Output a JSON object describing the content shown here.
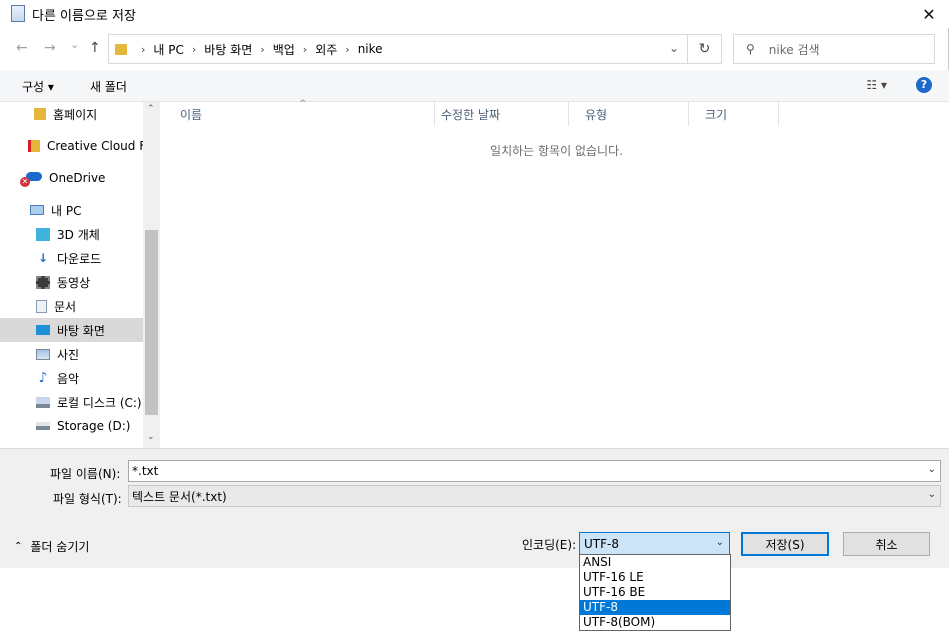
{
  "window": {
    "title": "다른 이름으로 저장",
    "close_glyph": "✕"
  },
  "address": {
    "back_glyph": "←",
    "forward_glyph": "→",
    "dropdown_glyph": "⌄",
    "up_glyph": "↑",
    "breadcrumbs": [
      "내 PC",
      "바탕 화면",
      "백업",
      "외주",
      "nike"
    ],
    "separator": "›",
    "refresh_glyph": "↻",
    "search_placeholder": "nike 검색"
  },
  "toolbar": {
    "organize_label": "구성 ▾",
    "new_folder_label": "새 폴더",
    "view_glyph": "☷ ▾",
    "help_glyph": "?"
  },
  "nav_pane": {
    "items": [
      {
        "label": "홈페이지",
        "icon": "folder-icon"
      },
      {
        "label": "Creative Cloud Fil",
        "icon": "creative-cloud-icon"
      },
      {
        "label": "OneDrive",
        "icon": "onedrive-icon"
      },
      {
        "label": "내 PC",
        "icon": "computer-icon"
      },
      {
        "label": "3D 개체",
        "icon": "cube-icon"
      },
      {
        "label": "다운로드",
        "icon": "download-icon"
      },
      {
        "label": "동영상",
        "icon": "video-icon"
      },
      {
        "label": "문서",
        "icon": "document-icon"
      },
      {
        "label": "바탕 화면",
        "icon": "desktop-icon"
      },
      {
        "label": "사진",
        "icon": "picture-icon"
      },
      {
        "label": "음악",
        "icon": "music-icon"
      },
      {
        "label": "로컬 디스크 (C:)",
        "icon": "drive-icon"
      },
      {
        "label": "Storage (D:)",
        "icon": "drive-icon"
      }
    ],
    "selected_index": 8,
    "scroll_up_glyph": "⌃",
    "scroll_down_glyph": "⌄"
  },
  "file_list": {
    "columns": [
      "이름",
      "수정한 날짜",
      "유형",
      "크기"
    ],
    "sort_glyph": "^",
    "empty_message": "일치하는 항목이 없습니다."
  },
  "bottom": {
    "filename_label": "파일 이름(N):",
    "filename_value": "*.txt",
    "filetype_label": "파일 형식(T):",
    "filetype_value": "텍스트 문서(*.txt)",
    "hide_folders_label": "폴더 숨기기",
    "hide_folders_glyph": "⌃",
    "encoding_label": "인코딩(E):",
    "encoding_value": "UTF-8",
    "save_label": "저장(S)",
    "cancel_label": "취소",
    "dropdown_glyph": "⌄"
  },
  "encoding_options": [
    "ANSI",
    "UTF-16 LE",
    "UTF-16 BE",
    "UTF-8",
    "UTF-8(BOM)"
  ],
  "encoding_selected_index": 3,
  "colors": {
    "accent": "#0078d7",
    "selection_bg": "#cce4f7",
    "panel_bg": "#f0f0f0",
    "folder": "#e6b53c"
  }
}
